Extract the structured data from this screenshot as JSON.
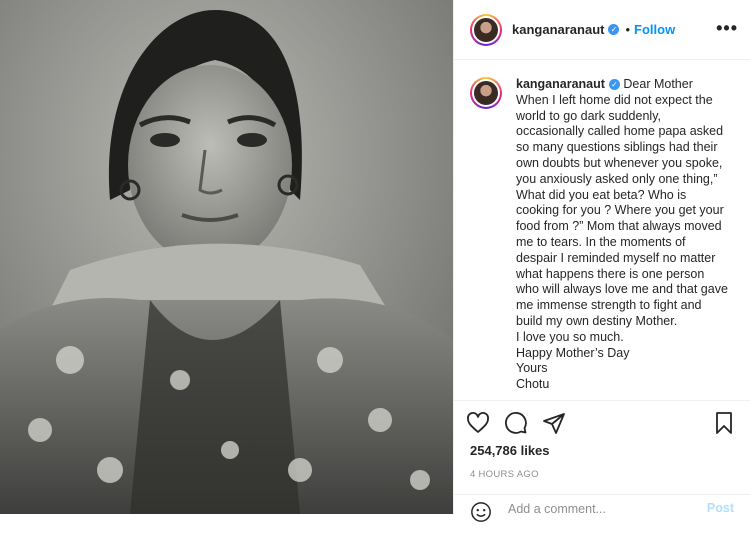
{
  "post": {
    "username": "kanganaranaut",
    "follow_label": "Follow",
    "dot": "•",
    "more": "•••"
  },
  "caption": {
    "username": "kanganaranaut",
    "lines": [
      "Dear Mother",
      "When I left home did not expect the",
      "world to go dark suddenly,",
      "occasionally called home papa asked",
      "so many questions siblings had their",
      "own doubts but whenever you spoke,",
      "you anxiously asked only one thing,”",
      "What did you eat beta? Who is",
      "cooking for you ? Where you get your",
      "food from ?” Mom that always moved",
      "me to tears. In the moments of",
      "despair I reminded myself no matter",
      "what happens there is one person",
      "who will always love me and that gave",
      "me immense strength to fight and",
      "build my own destiny Mother.",
      "I love you so much.",
      "Happy Mother’s Day",
      "Yours",
      "Chotu"
    ]
  },
  "stats": {
    "likes": "254,786 likes",
    "time": "4 HOURS AGO"
  },
  "comment": {
    "placeholder": "Add a comment...",
    "post_label": "Post"
  },
  "icons": {
    "like": "heart-icon",
    "comment": "comment-icon",
    "share": "share-icon",
    "save": "bookmark-icon",
    "emoji": "emoji-icon",
    "verified": "verified-badge-icon"
  },
  "colors": {
    "accent": "#0095f6",
    "verified": "#3897f0",
    "muted": "#8e8e8e"
  }
}
